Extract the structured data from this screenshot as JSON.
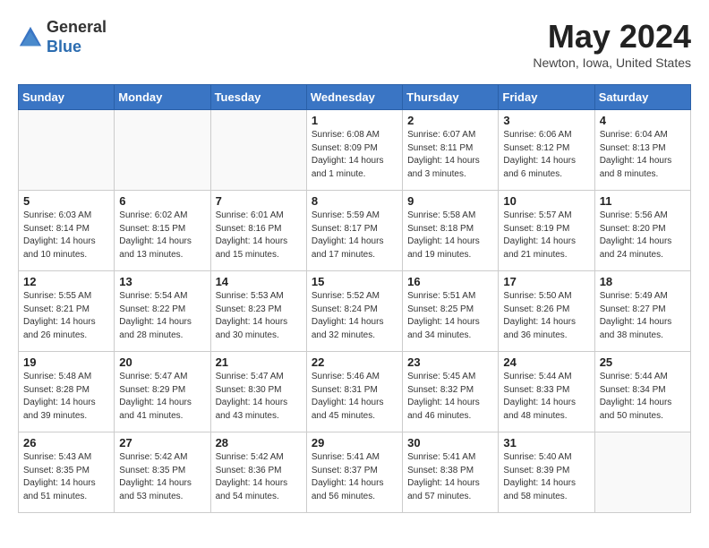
{
  "header": {
    "logo_general": "General",
    "logo_blue": "Blue",
    "month_title": "May 2024",
    "location": "Newton, Iowa, United States"
  },
  "weekdays": [
    "Sunday",
    "Monday",
    "Tuesday",
    "Wednesday",
    "Thursday",
    "Friday",
    "Saturday"
  ],
  "weeks": [
    [
      {
        "day": "",
        "sunrise": "",
        "sunset": "",
        "daylight": ""
      },
      {
        "day": "",
        "sunrise": "",
        "sunset": "",
        "daylight": ""
      },
      {
        "day": "",
        "sunrise": "",
        "sunset": "",
        "daylight": ""
      },
      {
        "day": "1",
        "sunrise": "Sunrise: 6:08 AM",
        "sunset": "Sunset: 8:09 PM",
        "daylight": "Daylight: 14 hours and 1 minute."
      },
      {
        "day": "2",
        "sunrise": "Sunrise: 6:07 AM",
        "sunset": "Sunset: 8:11 PM",
        "daylight": "Daylight: 14 hours and 3 minutes."
      },
      {
        "day": "3",
        "sunrise": "Sunrise: 6:06 AM",
        "sunset": "Sunset: 8:12 PM",
        "daylight": "Daylight: 14 hours and 6 minutes."
      },
      {
        "day": "4",
        "sunrise": "Sunrise: 6:04 AM",
        "sunset": "Sunset: 8:13 PM",
        "daylight": "Daylight: 14 hours and 8 minutes."
      }
    ],
    [
      {
        "day": "5",
        "sunrise": "Sunrise: 6:03 AM",
        "sunset": "Sunset: 8:14 PM",
        "daylight": "Daylight: 14 hours and 10 minutes."
      },
      {
        "day": "6",
        "sunrise": "Sunrise: 6:02 AM",
        "sunset": "Sunset: 8:15 PM",
        "daylight": "Daylight: 14 hours and 13 minutes."
      },
      {
        "day": "7",
        "sunrise": "Sunrise: 6:01 AM",
        "sunset": "Sunset: 8:16 PM",
        "daylight": "Daylight: 14 hours and 15 minutes."
      },
      {
        "day": "8",
        "sunrise": "Sunrise: 5:59 AM",
        "sunset": "Sunset: 8:17 PM",
        "daylight": "Daylight: 14 hours and 17 minutes."
      },
      {
        "day": "9",
        "sunrise": "Sunrise: 5:58 AM",
        "sunset": "Sunset: 8:18 PM",
        "daylight": "Daylight: 14 hours and 19 minutes."
      },
      {
        "day": "10",
        "sunrise": "Sunrise: 5:57 AM",
        "sunset": "Sunset: 8:19 PM",
        "daylight": "Daylight: 14 hours and 21 minutes."
      },
      {
        "day": "11",
        "sunrise": "Sunrise: 5:56 AM",
        "sunset": "Sunset: 8:20 PM",
        "daylight": "Daylight: 14 hours and 24 minutes."
      }
    ],
    [
      {
        "day": "12",
        "sunrise": "Sunrise: 5:55 AM",
        "sunset": "Sunset: 8:21 PM",
        "daylight": "Daylight: 14 hours and 26 minutes."
      },
      {
        "day": "13",
        "sunrise": "Sunrise: 5:54 AM",
        "sunset": "Sunset: 8:22 PM",
        "daylight": "Daylight: 14 hours and 28 minutes."
      },
      {
        "day": "14",
        "sunrise": "Sunrise: 5:53 AM",
        "sunset": "Sunset: 8:23 PM",
        "daylight": "Daylight: 14 hours and 30 minutes."
      },
      {
        "day": "15",
        "sunrise": "Sunrise: 5:52 AM",
        "sunset": "Sunset: 8:24 PM",
        "daylight": "Daylight: 14 hours and 32 minutes."
      },
      {
        "day": "16",
        "sunrise": "Sunrise: 5:51 AM",
        "sunset": "Sunset: 8:25 PM",
        "daylight": "Daylight: 14 hours and 34 minutes."
      },
      {
        "day": "17",
        "sunrise": "Sunrise: 5:50 AM",
        "sunset": "Sunset: 8:26 PM",
        "daylight": "Daylight: 14 hours and 36 minutes."
      },
      {
        "day": "18",
        "sunrise": "Sunrise: 5:49 AM",
        "sunset": "Sunset: 8:27 PM",
        "daylight": "Daylight: 14 hours and 38 minutes."
      }
    ],
    [
      {
        "day": "19",
        "sunrise": "Sunrise: 5:48 AM",
        "sunset": "Sunset: 8:28 PM",
        "daylight": "Daylight: 14 hours and 39 minutes."
      },
      {
        "day": "20",
        "sunrise": "Sunrise: 5:47 AM",
        "sunset": "Sunset: 8:29 PM",
        "daylight": "Daylight: 14 hours and 41 minutes."
      },
      {
        "day": "21",
        "sunrise": "Sunrise: 5:47 AM",
        "sunset": "Sunset: 8:30 PM",
        "daylight": "Daylight: 14 hours and 43 minutes."
      },
      {
        "day": "22",
        "sunrise": "Sunrise: 5:46 AM",
        "sunset": "Sunset: 8:31 PM",
        "daylight": "Daylight: 14 hours and 45 minutes."
      },
      {
        "day": "23",
        "sunrise": "Sunrise: 5:45 AM",
        "sunset": "Sunset: 8:32 PM",
        "daylight": "Daylight: 14 hours and 46 minutes."
      },
      {
        "day": "24",
        "sunrise": "Sunrise: 5:44 AM",
        "sunset": "Sunset: 8:33 PM",
        "daylight": "Daylight: 14 hours and 48 minutes."
      },
      {
        "day": "25",
        "sunrise": "Sunrise: 5:44 AM",
        "sunset": "Sunset: 8:34 PM",
        "daylight": "Daylight: 14 hours and 50 minutes."
      }
    ],
    [
      {
        "day": "26",
        "sunrise": "Sunrise: 5:43 AM",
        "sunset": "Sunset: 8:35 PM",
        "daylight": "Daylight: 14 hours and 51 minutes."
      },
      {
        "day": "27",
        "sunrise": "Sunrise: 5:42 AM",
        "sunset": "Sunset: 8:35 PM",
        "daylight": "Daylight: 14 hours and 53 minutes."
      },
      {
        "day": "28",
        "sunrise": "Sunrise: 5:42 AM",
        "sunset": "Sunset: 8:36 PM",
        "daylight": "Daylight: 14 hours and 54 minutes."
      },
      {
        "day": "29",
        "sunrise": "Sunrise: 5:41 AM",
        "sunset": "Sunset: 8:37 PM",
        "daylight": "Daylight: 14 hours and 56 minutes."
      },
      {
        "day": "30",
        "sunrise": "Sunrise: 5:41 AM",
        "sunset": "Sunset: 8:38 PM",
        "daylight": "Daylight: 14 hours and 57 minutes."
      },
      {
        "day": "31",
        "sunrise": "Sunrise: 5:40 AM",
        "sunset": "Sunset: 8:39 PM",
        "daylight": "Daylight: 14 hours and 58 minutes."
      },
      {
        "day": "",
        "sunrise": "",
        "sunset": "",
        "daylight": ""
      }
    ]
  ]
}
